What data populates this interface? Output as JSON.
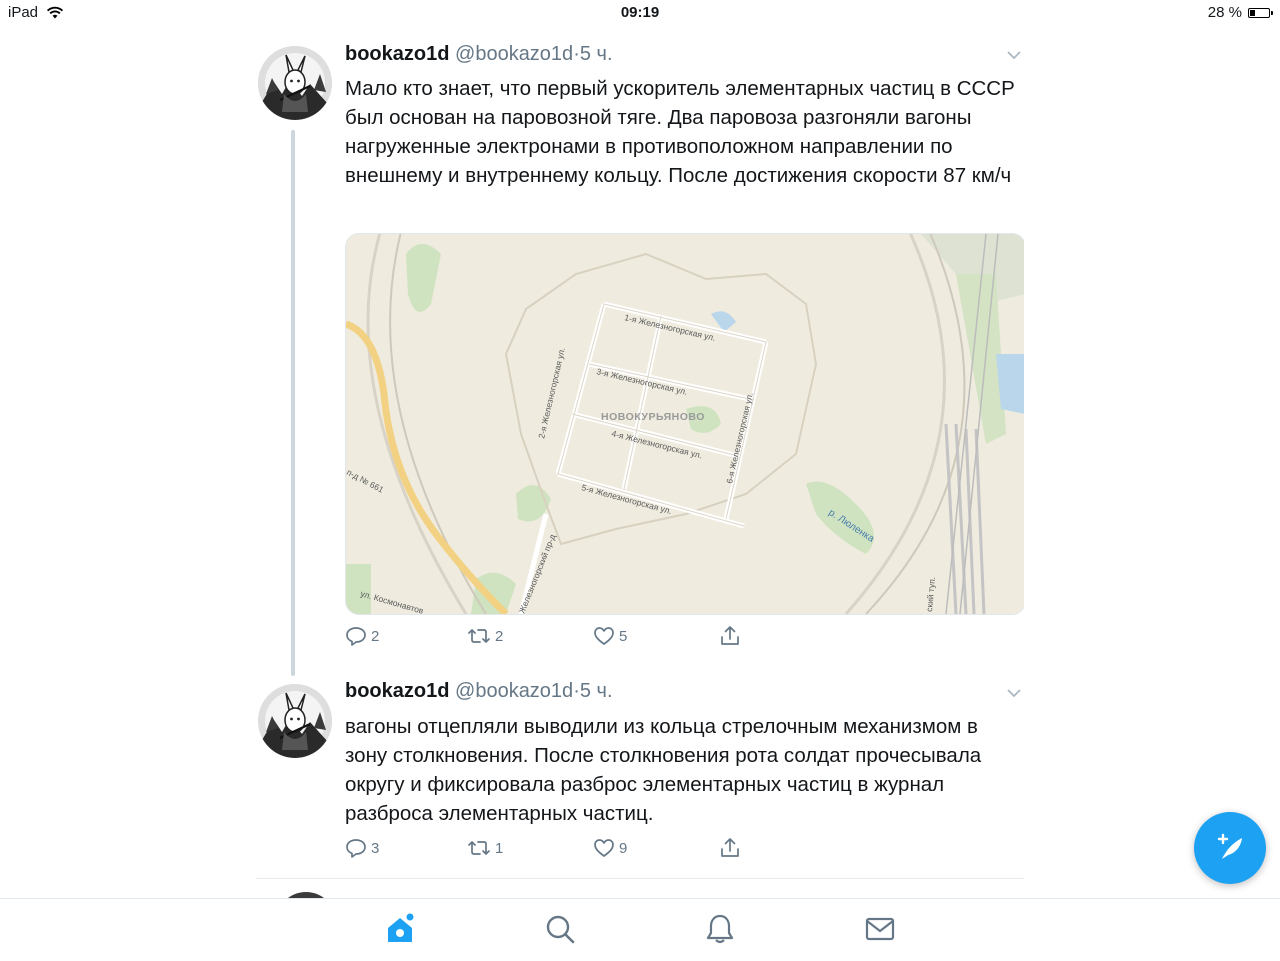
{
  "status_bar": {
    "device": "iPad",
    "time": "09:19",
    "battery": "28 %",
    "battery_level": 0.28
  },
  "tweets": [
    {
      "name": "bookazo1d",
      "handle": "@bookazo1d",
      "separator": "·",
      "time": "5 ч.",
      "text": "Мало кто знает, что первый ускоритель элементарных частиц в СССР был основан на паровозной тяге. Два паровоза разгоняли вагоны нагруженные электронами в противоположном направлении по внешнему и внутреннему кольцу. После достижения скорости 87 км/ч",
      "replies": "2",
      "retweets": "2",
      "likes": "5",
      "map": {
        "district": "НОВОКУРЬЯНОВО",
        "streets": [
          "1-я Железногорская ул.",
          "3-я Железногорская ул.",
          "4-я Железногорская ул.",
          "5-я Железногорская ул.",
          "2-я Железногорская ул.",
          "6-я Железногорская ул."
        ],
        "river": "р. Люленка",
        "road": "п-д № 661",
        "street_bottom": "ул. Космонавтов",
        "passage": "Железногорский пр-д",
        "lane": "ский туп."
      }
    },
    {
      "name": "bookazo1d",
      "handle": "@bookazo1d",
      "separator": "·",
      "time": "5 ч.",
      "text": "вагоны отцепляли выводили из кольца стрелочным механизмом в зону столкновения. После столкновения рота солдат прочесывала округу и фиксировала разброс элементарных частиц в журнал разброса элементарных частиц.",
      "replies": "3",
      "retweets": "1",
      "likes": "9"
    }
  ],
  "icons": {
    "wifi": "wifi-icon",
    "battery": "battery-icon",
    "caret": "chevron-down-icon",
    "reply": "reply-icon",
    "retweet": "retweet-icon",
    "like": "heart-icon",
    "share": "share-icon",
    "home": "home-icon",
    "search": "search-icon",
    "notifications": "bell-icon",
    "messages": "mail-icon",
    "compose": "compose-tweet-icon"
  },
  "colors": {
    "accent": "#1da1f2",
    "secondary_text": "#657786",
    "text": "#14171a",
    "thread_line": "#ccd6dd"
  }
}
